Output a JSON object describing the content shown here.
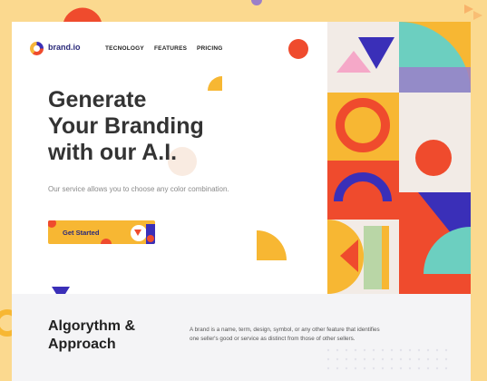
{
  "brand": {
    "name": "brand.io",
    "logo_icon": "brand-logo-icon"
  },
  "nav": {
    "links": [
      "TECNOLOGY",
      "FEATURES",
      "PRICING"
    ]
  },
  "hero": {
    "title_lines": [
      "Generate",
      "Your Branding",
      "with our A.I."
    ],
    "subtitle": "Our service allows you to choose any color combination.",
    "cta_label": "Get Started"
  },
  "section": {
    "title_lines": [
      "Algorythm &",
      "Approach"
    ],
    "description": "A brand is a name, term, design, symbol, or any other feature that identifies one seller's good or service as distinct from those of other sellers."
  },
  "colors": {
    "background": "#fbd98f",
    "accent_orange": "#ef4b2d",
    "accent_yellow": "#f7b733",
    "accent_navy": "#2a2a7a",
    "accent_purple": "#3a2fb8",
    "accent_teal": "#6ccfc0"
  }
}
